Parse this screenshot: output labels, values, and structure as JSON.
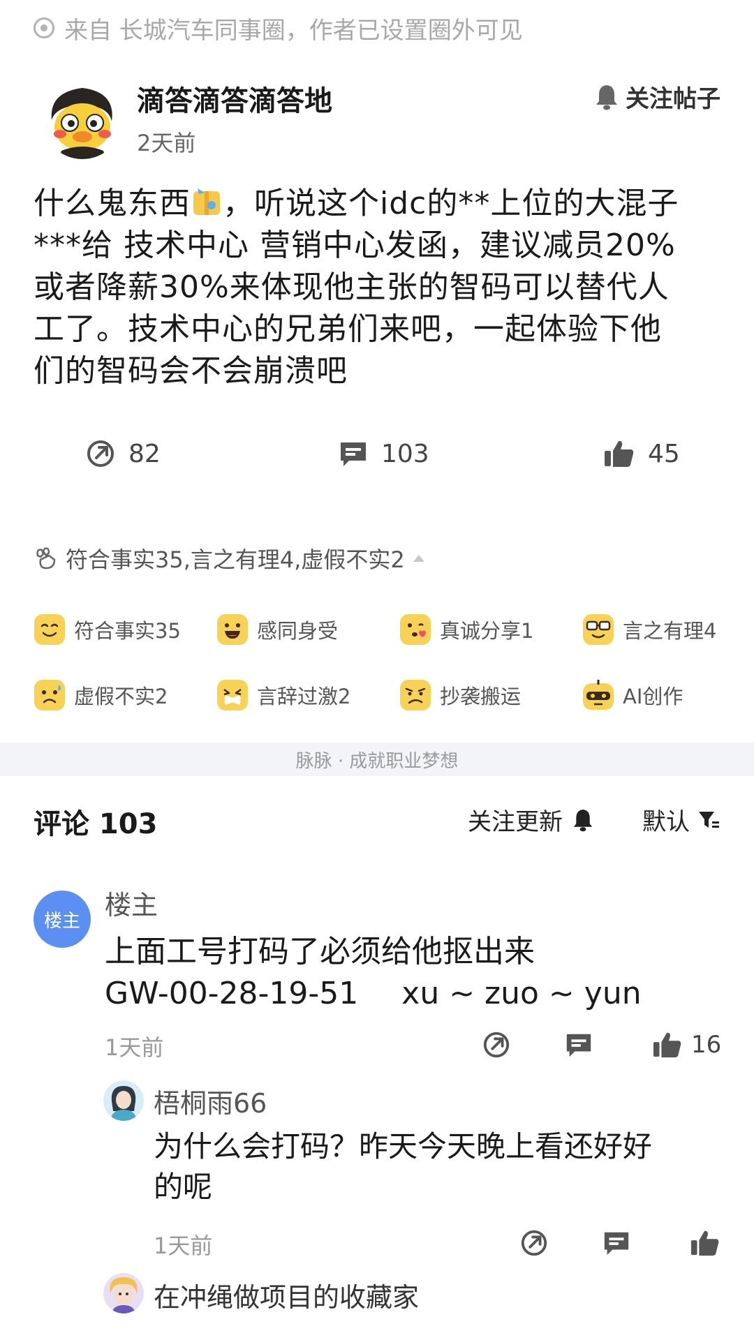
{
  "source_note": "来自 长城汽车同事圈，作者已设置圈外可见",
  "post": {
    "author": "滴答滴答滴答地",
    "time": "2天前",
    "follow_label": "关注帖子",
    "body_line1_a": "什么鬼东西",
    "body_line1_b": "，听说这个idc的**上位的大混子",
    "body_line2": "***给  技术中心  营销中心发函，建议减员20%",
    "body_line3": "或者降薪30%来体现他主张的智码可以替代人",
    "body_line4": "工了。技术中心的兄弟们来吧，一起体验下他",
    "body_line5": "们的智码会不会崩溃吧"
  },
  "stats": {
    "shares": "82",
    "comments": "103",
    "likes": "45"
  },
  "judgement_summary": "符合事实35,言之有理4,虚假不实2",
  "reactions": [
    {
      "label": "符合事实35",
      "icon": "smile-face-icon"
    },
    {
      "label": "感同身受",
      "icon": "grin-face-icon"
    },
    {
      "label": "真诚分享1",
      "icon": "kiss-face-icon"
    },
    {
      "label": "言之有理4",
      "icon": "glasses-face-icon"
    },
    {
      "label": "虚假不实2",
      "icon": "sweat-face-icon"
    },
    {
      "label": "言辞过激2",
      "icon": "muted-face-icon"
    },
    {
      "label": "抄袭搬运",
      "icon": "frown-face-icon"
    },
    {
      "label": "AI创作",
      "icon": "robot-face-icon"
    }
  ],
  "footer_slogan": "脉脉 · 成就职业梦想",
  "comments_header": {
    "title": "评论 103",
    "follow_updates": "关注更新",
    "sort": "默认"
  },
  "comment1": {
    "badge": "楼主",
    "name": "楼主",
    "text_line1": "上面工号打码了必须给他抠出来",
    "text_line2_a": "GW-00-28-19-51",
    "text_line2_b": "xu ~ zuo ~ yun",
    "time": "1天前",
    "likes": "16"
  },
  "reply1": {
    "name": "梧桐雨66",
    "text_line1": "为什么会打码？昨天今天晚上看还好好",
    "text_line2": "的呢",
    "time": "1天前"
  },
  "reply2": {
    "name": "在冲绳做项目的收藏家"
  },
  "colors": {
    "badge_blue": "#5b8ff1",
    "reaction_yellow": "#f7d257",
    "divider_band": "#f2f4f8"
  }
}
